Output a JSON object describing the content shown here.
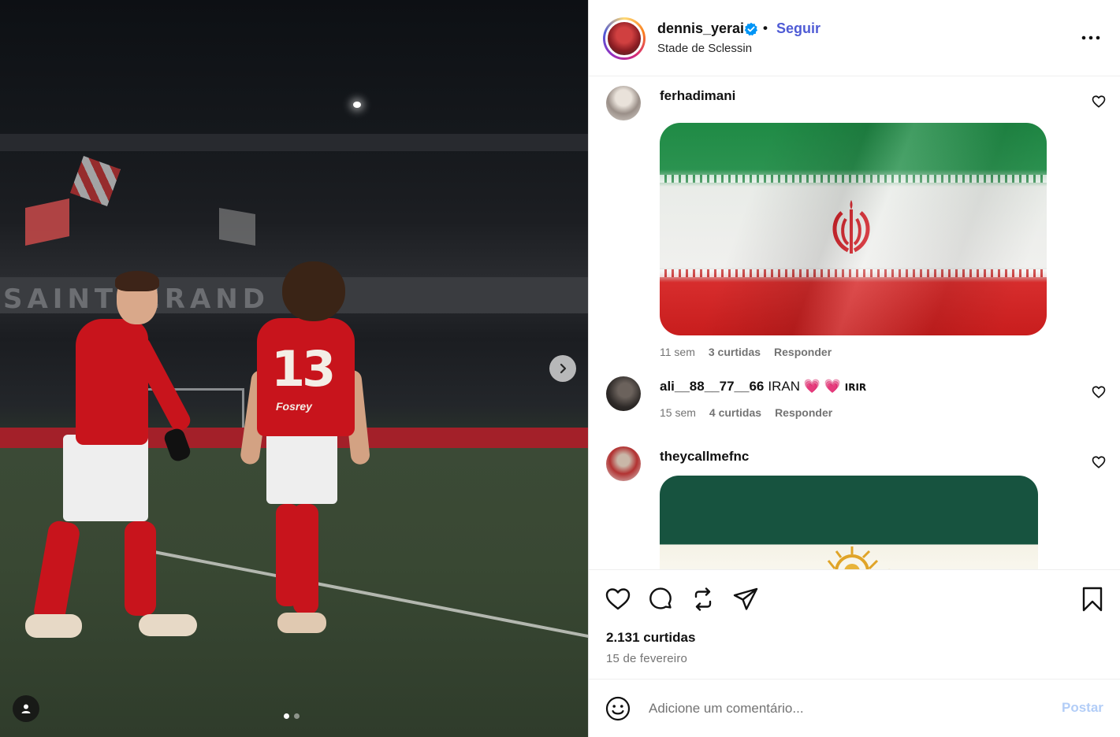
{
  "post": {
    "username": "dennis_yerai",
    "separator": "•",
    "follow_label": "Seguir",
    "location": "Stade de Sclessin",
    "media": {
      "player_number": "13",
      "shirt_sponsor": "Fosrey",
      "stadium_banner": "SAINTSERAND",
      "carousel_index": 1,
      "carousel_count": 2
    }
  },
  "comments": [
    {
      "username": "ferhadimani",
      "text": "",
      "media": "iran-flag-image",
      "time": "11 sem",
      "likes": "3 curtidas",
      "reply": "Responder"
    },
    {
      "username": "ali__88__77__66",
      "text": "IRAN 💗 💗",
      "tag": "IRIR",
      "time": "15 sem",
      "likes": "4 curtidas",
      "reply": "Responder"
    },
    {
      "username": "theycallmefnc",
      "text": "",
      "media": "lion-and-sun-flag-image"
    }
  ],
  "footer": {
    "likes": "2.131 curtidas",
    "date": "15 de fevereiro",
    "comment_placeholder": "Adicione um comentário...",
    "post_label": "Postar"
  },
  "colors": {
    "follow": "#4f5bd5",
    "verified": "#0095f6",
    "post_disabled": "#b2cdf7",
    "muted": "#737373"
  }
}
